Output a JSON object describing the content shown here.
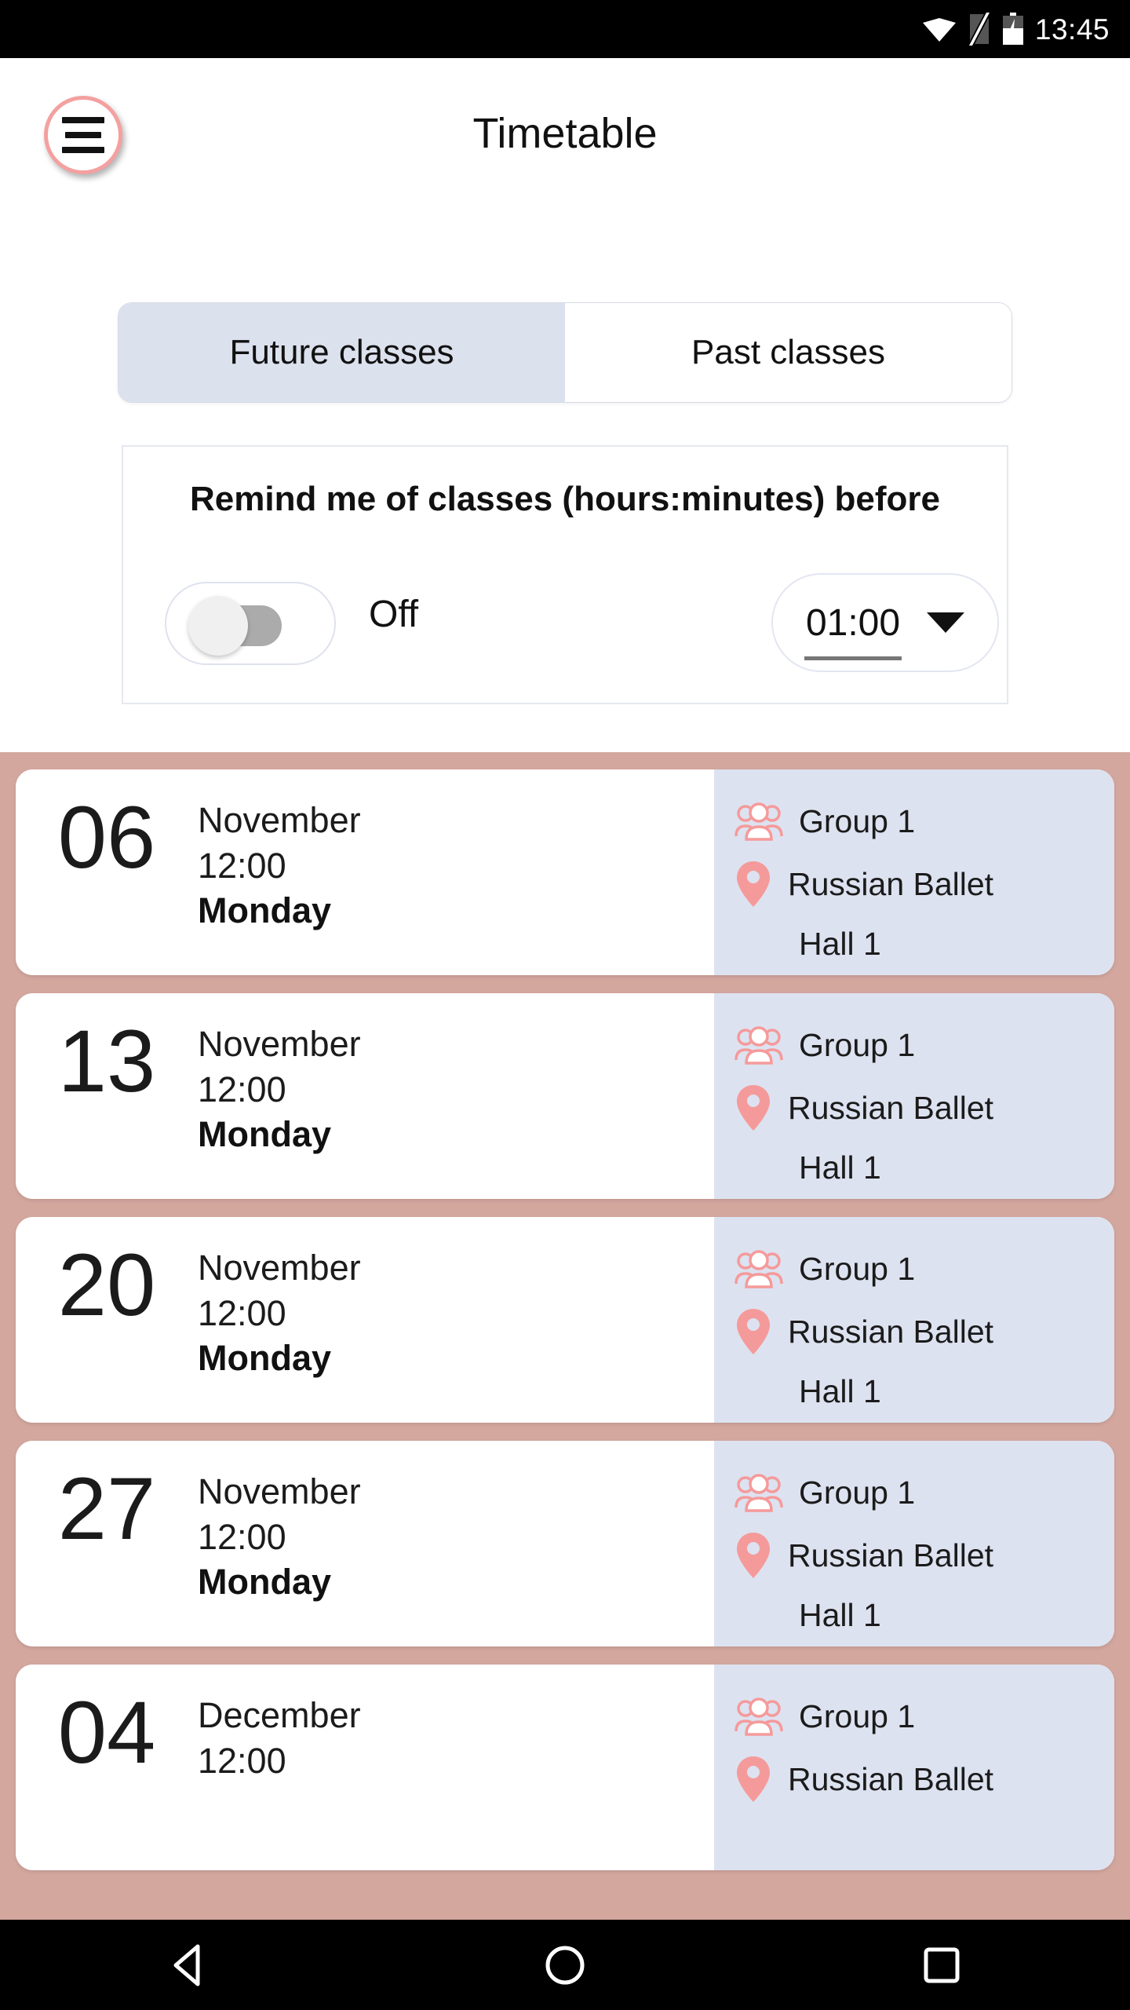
{
  "status_bar": {
    "time": "13:45",
    "icons": [
      "wifi-icon",
      "sim-card-off-icon",
      "battery-charging-icon"
    ]
  },
  "header": {
    "menu_icon": "hamburger-menu-icon",
    "title": "Timetable"
  },
  "tabs": [
    {
      "label": "Future classes",
      "active": true
    },
    {
      "label": "Past classes",
      "active": false
    }
  ],
  "reminder": {
    "title": "Remind me of classes (hours:minutes) before",
    "toggle_state_label": "Off",
    "toggle_on": false,
    "dropdown_value": "01:00",
    "dropdown_caret_icon": "chevron-down-icon"
  },
  "colors": {
    "accent_pink": "#F4A0A0",
    "list_background": "#D3A79E",
    "info_panel": "#DDE2F0",
    "tab_active": "#DCE1EE"
  },
  "classes": [
    {
      "day": "06",
      "month": "November",
      "time": "12:00",
      "weekday": "Monday",
      "group": "Group 1",
      "location": "Russian Ballet",
      "hall": "Hall 1",
      "group_icon": "people-group-icon",
      "location_icon": "map-pin-icon"
    },
    {
      "day": "13",
      "month": "November",
      "time": "12:00",
      "weekday": "Monday",
      "group": "Group 1",
      "location": "Russian Ballet",
      "hall": "Hall 1",
      "group_icon": "people-group-icon",
      "location_icon": "map-pin-icon"
    },
    {
      "day": "20",
      "month": "November",
      "time": "12:00",
      "weekday": "Monday",
      "group": "Group 1",
      "location": "Russian Ballet",
      "hall": "Hall 1",
      "group_icon": "people-group-icon",
      "location_icon": "map-pin-icon"
    },
    {
      "day": "27",
      "month": "November",
      "time": "12:00",
      "weekday": "Monday",
      "group": "Group 1",
      "location": "Russian Ballet",
      "hall": "Hall 1",
      "group_icon": "people-group-icon",
      "location_icon": "map-pin-icon"
    },
    {
      "day": "04",
      "month": "December",
      "time": "12:00",
      "weekday": "",
      "group": "Group 1",
      "location": "Russian Ballet",
      "hall": "",
      "group_icon": "people-group-icon",
      "location_icon": "map-pin-icon"
    }
  ],
  "nav_bar": {
    "back_icon": "triangle-back-icon",
    "home_icon": "circle-home-icon",
    "recents_icon": "square-recents-icon"
  }
}
